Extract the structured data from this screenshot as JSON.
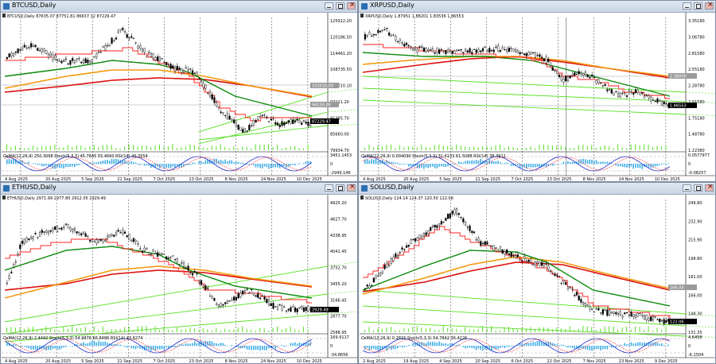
{
  "windows": [
    {
      "id": "btc",
      "title": "BTCUSD,Daily",
      "header": "BTCUSD,Daily  87635.07 87751.81 86637.32 87229.47",
      "price_labels": [
        "125912.20",
        "120186.50",
        "114461.20",
        "108735.50",
        "103010.10",
        "97111.20",
        "91385.70",
        "85660.00",
        "79934.70"
      ],
      "tag_labels": [
        "103010.00",
        "94230.00",
        "87229.47"
      ],
      "ind_header": "OsMA(12,26,9) 250.3068  Stoch(5,3,3) 45.7645  55.4660  RSI(14) 40.3554",
      "ind_labels": [
        "3451.1453",
        "0",
        "-2949.146"
      ],
      "dates": [
        "4 Aug 2025",
        "20 Aug 2025",
        "5 Sep 2025",
        "21 Sep 2025",
        "7 Oct 2025",
        "23 Oct 2025",
        "8 Nov 2025",
        "24 Nov 2025",
        "10 Dec 2025"
      ]
    },
    {
      "id": "xrp",
      "title": "XRPUSD,Daily",
      "header": "XRPUSD,Daily  1.87951 1.88201 1.83536 1.86553",
      "price_labels": [
        "3.35180",
        "3.06780",
        "2.81580",
        "2.55180",
        "2.28780",
        "2.01580",
        "1.75180",
        "1.48780",
        "1.22380"
      ],
      "tag_labels": [
        "2.38000",
        "1.86553"
      ],
      "ind_header": "OsMA(12,26,9) 0.004090  Stoch(5,3,3) 31.6133  61.5088  RSI(14) 38.4911",
      "ind_labels": [
        "0.0577977",
        "0",
        "-0.08257"
      ],
      "dates": [
        "4 Aug 2025",
        "20 Aug 2025",
        "5 Sep 2025",
        "21 Sep 2025",
        "7 Oct 2025",
        "23 Oct 2025",
        "8 Nov 2025",
        "24 Nov 2025",
        "10 Dec 2025"
      ]
    },
    {
      "id": "eth",
      "title": "ETHUSD,Daily",
      "header": "ETHUSD,Daily  2971.99 2977.80 2912.05 2929.49",
      "price_labels": [
        "4925.20",
        "4627.70",
        "4338.95",
        "4041.45",
        "3752.70",
        "3455.20",
        "3166.45",
        "2877.70",
        "2588.95"
      ],
      "tag_labels": [
        "2929.49"
      ],
      "ind_header": "OsMA(12,26,9) 2.4492  Stoch(5,3,3) 54.9876  66.8488  RSI(14) 43.6274",
      "ind_labels": [
        "169.9117",
        "0",
        "-34.8656"
      ],
      "dates": [
        "4 Aug 2025",
        "20 Aug 2025",
        "5 Sep 2025",
        "21 Sep 2025",
        "7 Oct 2025",
        "23 Oct 2025",
        "8 Nov 2025",
        "24 Nov 2025",
        "10 Dec 2025"
      ]
    },
    {
      "id": "sol",
      "title": "SOLUSD,Daily",
      "header": "SOLUSD,Daily  124.14 124.37 120.50 122.06",
      "price_labels": [
        "249.80",
        "232.90",
        "215.90",
        "198.80",
        "181.00",
        "166.00",
        "148.30",
        "131.35"
      ],
      "tag_labels": [
        "166.00",
        "122.06"
      ],
      "ind_header": "OsMA(12,26,9) 0.2815  Stoch(5,3,3) 54.7842  36.4226",
      "ind_labels": [
        "4.6458",
        "0",
        "-6.1504"
      ],
      "dates": [
        "2 Aug 2025",
        "19 Aug 2025",
        "4 Sep 2025",
        "20 Sep 2025",
        "6 Oct 2025",
        "22 Oct 2025",
        "7 Nov 2025",
        "23 Nov 2025",
        "9 Dec 2025"
      ]
    }
  ],
  "colors": {
    "candle": "#000000",
    "ma_green": "#0a8a0a",
    "ma_orange": "#f39a10",
    "ma_red": "#dd1010",
    "channel": "#55e020",
    "stop_red": "#ff2020",
    "stop_blue": "#1010e0",
    "osma": "#42aee6",
    "stoch": "#1a26c8",
    "rsi_signal": "#ff3030",
    "level_line": "#9a9a9a"
  }
}
